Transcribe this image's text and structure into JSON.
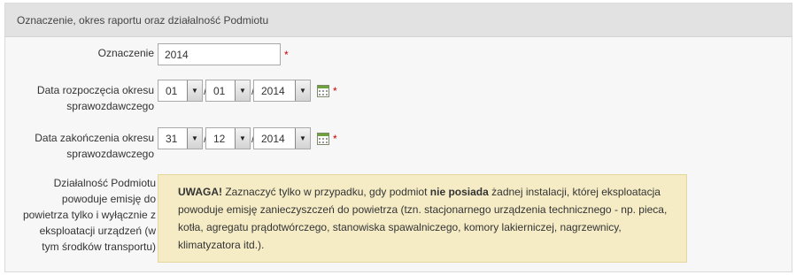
{
  "section": {
    "title": "Oznaczenie, okres raportu oraz działalność Podmiotu"
  },
  "fields": {
    "oznaczenie": {
      "label": "Oznaczenie",
      "value": "2014",
      "required_mark": "*"
    },
    "start_date": {
      "label_line1": "Data rozpoczęcia okresu",
      "label_line2": "sprawozdawczego",
      "day": "01",
      "month": "01",
      "year": "2014",
      "separator": "/",
      "required_mark": "*"
    },
    "end_date": {
      "label_line1": "Data zakończenia okresu",
      "label_line2": "sprawozdawczego",
      "day": "31",
      "month": "12",
      "year": "2014",
      "separator": "/",
      "required_mark": "*"
    },
    "activity": {
      "label_lines": [
        "Działalność Podmiotu",
        "powoduje emisję do",
        "powietrza tylko i wyłącznie z",
        "eksploatacji urządzeń (w",
        "tym środków transportu)"
      ],
      "checked": true,
      "check_glyph": "✓"
    }
  },
  "warning": {
    "bold_prefix": "UWAGA!",
    "text_before": " Zaznaczyć tylko w przypadku, gdy podmiot ",
    "bold_mid": "nie posiada",
    "text_after": " żadnej instalacji, której eksploatacja powoduje emisję zanieczyszczeń do powietrza (tzn. stacjonarnego urządzenia technicznego - np. pieca, kotła, agregatu prądotwórczego, stanowiska spawalniczego, komory lakierniczej, nagrzewnicy, klimatyzatora itd.)."
  },
  "icons": {
    "select_arrow": "▼",
    "calendar": "calendar-icon"
  },
  "colors": {
    "required": "#cc0000",
    "warning_bg": "#f5ecc6",
    "header_bg": "#e2e2e2",
    "panel_bg": "#f7f7f7",
    "checkbox_mark": "#2d4ba0"
  }
}
